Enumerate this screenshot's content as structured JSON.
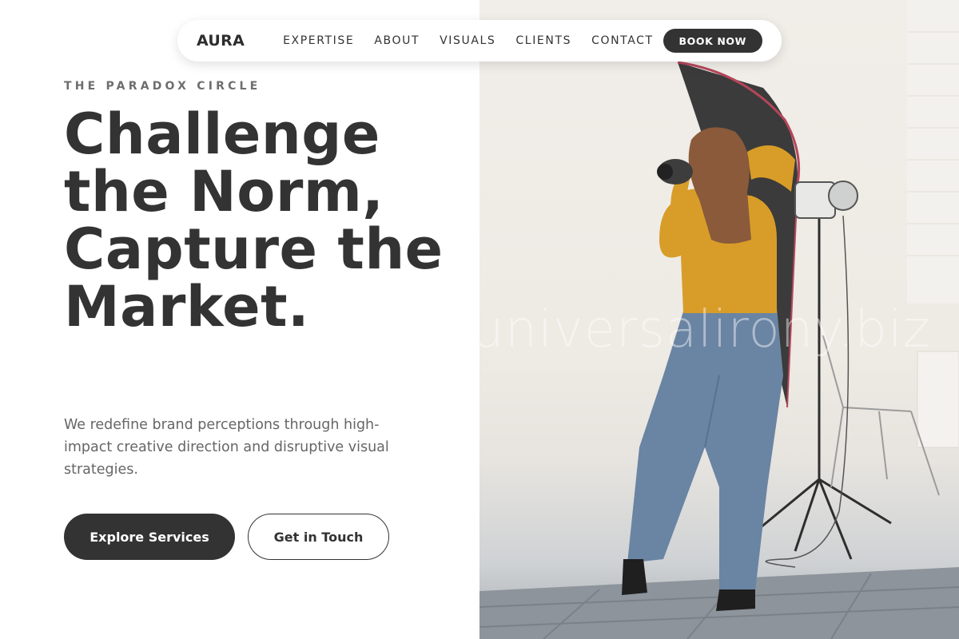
{
  "nav": {
    "logo": "AURA",
    "links": [
      "EXPERTISE",
      "ABOUT",
      "VISUALS",
      "CLIENTS",
      "CONTACT"
    ],
    "cta": "BOOK NOW"
  },
  "hero": {
    "eyebrow": "THE PARADOX CIRCLE",
    "headline": "Challenge the Norm, Capture the Market.",
    "subtext": "We redefine brand perceptions through high-impact creative direction and disruptive visual strategies.",
    "primary_button": "Explore Services",
    "secondary_button": "Get in Touch"
  },
  "photo": {
    "watermark": "universalirony.biz",
    "alt": "Photographer in yellow sweater and jeans shooting in a bright studio with softbox lights"
  },
  "colors": {
    "dark": "#333333",
    "muted_text": "#666666",
    "background": "#ffffff"
  }
}
